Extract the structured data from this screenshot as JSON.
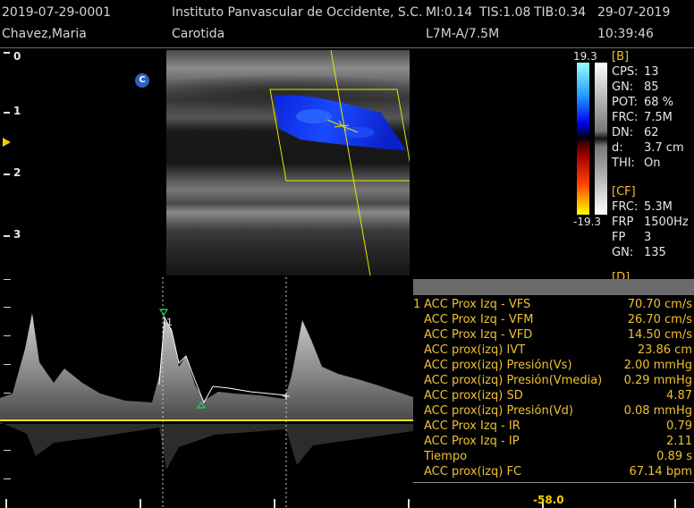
{
  "header": {
    "patient_id": "2019-07-29-0001",
    "patient_name": "Chavez,Maria",
    "institution": "Instituto Panvascular de Occidente, S.C.",
    "mi": "MI:0.14",
    "tis": "TIS:1.08",
    "tib": "TIB:0.34",
    "date": "29-07-2019",
    "exam": "Carotida",
    "probe": "L7M-A/7.5M",
    "time": "10:39:46"
  },
  "depth_scale": [
    "0",
    "1",
    "2",
    "3"
  ],
  "color_badge": "C",
  "color_scale": {
    "max": "19.3",
    "min": "-19.3"
  },
  "b_params": {
    "title": "[B]",
    "items": [
      {
        "label": "CPS:",
        "value": "13"
      },
      {
        "label": "GN:",
        "value": "85"
      },
      {
        "label": "POT:",
        "value": "68 %"
      },
      {
        "label": "FRC:",
        "value": "7.5M"
      },
      {
        "label": "DN:",
        "value": "62"
      },
      {
        "label": "d:",
        "value": "3.7 cm"
      },
      {
        "label": "THI:",
        "value": "On"
      }
    ]
  },
  "cf_params": {
    "title": "[CF]",
    "items": [
      {
        "label": "FRC:",
        "value": "5.3M"
      },
      {
        "label": "FRP",
        "value": "1500Hz"
      },
      {
        "label": "FP",
        "value": "3"
      },
      {
        "label": "GN:",
        "value": "135"
      }
    ],
    "partial": "[D]"
  },
  "measurements": {
    "index": "1",
    "rows": [
      {
        "label": "ACC Prox Izq - VFS",
        "value": "70.70 cm/s"
      },
      {
        "label": "ACC Prox Izq - VFM",
        "value": "26.70 cm/s"
      },
      {
        "label": "ACC Prox Izq - VFD",
        "value": "14.50 cm/s"
      },
      {
        "label": "ACC prox(izq) IVT",
        "value": "23.86 cm"
      },
      {
        "label": "ACC prox(izq) Presión(Vs)",
        "value": "2.00 mmHg"
      },
      {
        "label": "ACC prox(izq) Presión(Vmedia)",
        "value": "0.29 mmHg"
      },
      {
        "label": "ACC prox(izq) SD",
        "value": "4.87"
      },
      {
        "label": "ACC prox(izq) Presión(Vd)",
        "value": "0.08 mmHg"
      },
      {
        "label": "ACC Prox Izq - IR",
        "value": "0.79"
      },
      {
        "label": "ACC Prox Izq - IP",
        "value": "2.11"
      },
      {
        "label": "Tiempo",
        "value": "0.89 s"
      },
      {
        "label": "ACC prox(izq) FC",
        "value": "67.14 bpm"
      }
    ]
  },
  "doppler": {
    "peak_marker": "1",
    "scale_value": "-58.0"
  },
  "colors": {
    "accent_yellow": "#f0c030",
    "baseline": "#e8e800",
    "flow_blue": "#1030ff"
  }
}
